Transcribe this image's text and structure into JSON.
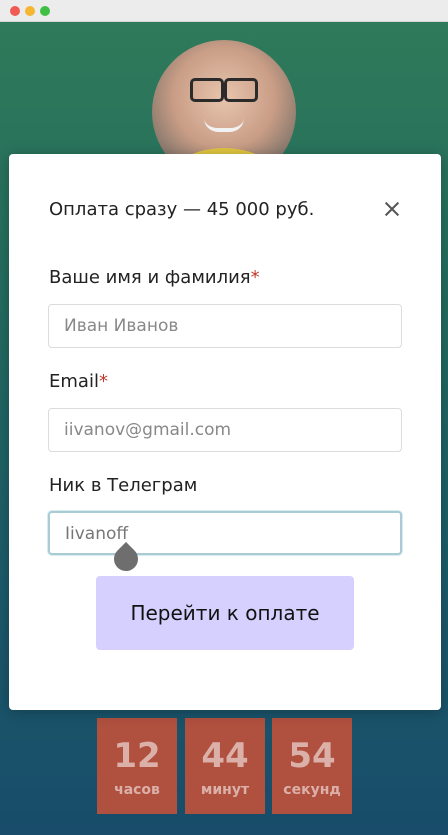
{
  "modal": {
    "title": "Оплата сразу — 45 000 руб.",
    "fields": [
      {
        "label": "Ваше имя и фамилия",
        "required_mark": "*",
        "value": "Иван Иванов"
      },
      {
        "label": "Email",
        "required_mark": "*",
        "value": "iivanov@gmail.com"
      },
      {
        "label": "Ник в Телеграм",
        "value": "Iivanoff"
      }
    ],
    "submit_label": "Перейти к оплате"
  },
  "timer": [
    {
      "value": "12",
      "unit": "часов"
    },
    {
      "value": "44",
      "unit": "минут"
    },
    {
      "value": "54",
      "unit": "секунд"
    }
  ],
  "colors": {
    "accent_button": "#d6d0ff",
    "required": "#c0392b",
    "timer_box": "#b0503f"
  }
}
